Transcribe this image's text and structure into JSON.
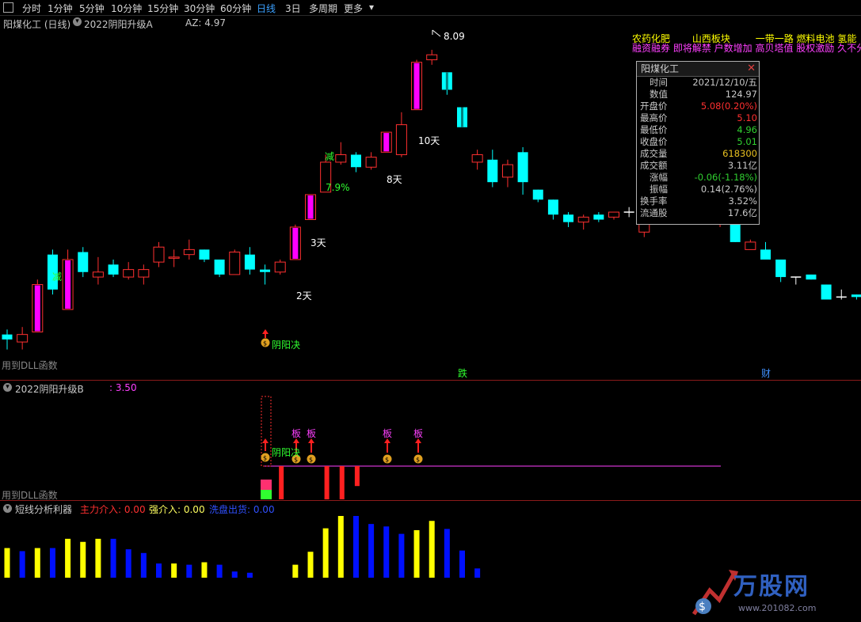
{
  "toolbar": {
    "tabs": [
      "分时",
      "1分钟",
      "5分钟",
      "10分钟",
      "15分钟",
      "30分钟",
      "60分钟",
      "日线",
      "3日",
      "多周期",
      "更多"
    ],
    "active_tab": "日线"
  },
  "main_panel": {
    "stock_title": "阳煤化工 (日线)",
    "indicator_name": "2022阴阳升级A",
    "az_label": "AZ: 4.97",
    "dll_note": "用到DLL函数",
    "high_marker": "8.09",
    "labels": {
      "jian1": "减",
      "jian2": "减",
      "pct": "7.9%",
      "day2": "2天",
      "day3": "3天",
      "day8": "8天",
      "day10": "10天",
      "yinyang": "阴阳决",
      "die": "跌",
      "cai": "财"
    },
    "concept_tags_row1": [
      "农药化肥",
      "山西板块",
      "一带一路",
      "燃料电池",
      "氢能"
    ],
    "concept_tags_row2": "融资融券 即将解禁 户数增加 高贝塔值 股权激励 久不分"
  },
  "info_box": {
    "title": "阳煤化工",
    "rows": [
      {
        "k": "时间",
        "v": "2021/12/10/五",
        "color": "#c8c8c8"
      },
      {
        "k": "数值",
        "v": "124.97",
        "color": "#c8c8c8"
      },
      {
        "k": "开盘价",
        "v": "5.08(0.20%)",
        "color": "#ff3030"
      },
      {
        "k": "最高价",
        "v": "5.10",
        "color": "#ff3030"
      },
      {
        "k": "最低价",
        "v": "4.96",
        "color": "#30d030"
      },
      {
        "k": "收盘价",
        "v": "5.01",
        "color": "#30d030"
      },
      {
        "k": "成交量",
        "v": "618300",
        "color": "#e8c020"
      },
      {
        "k": "成交额",
        "v": "3.11亿",
        "color": "#c8c8c8"
      },
      {
        "k": "涨幅",
        "v": "-0.06(-1.18%)",
        "color": "#30d030"
      },
      {
        "k": "振幅",
        "v": "0.14(2.76%)",
        "color": "#c8c8c8"
      },
      {
        "k": "换手率",
        "v": "3.52%",
        "color": "#c8c8c8"
      },
      {
        "k": "流通股",
        "v": "17.6亿",
        "color": "#c8c8c8"
      }
    ]
  },
  "panel_b": {
    "indicator_name": "2022阴阳升级B",
    "value": ": 3.50",
    "dll_note": "用到DLL函数",
    "ban_label": "板",
    "yinyang": "阴阳决"
  },
  "panel_c": {
    "indicator_name": "短线分析利器",
    "zhuli": "主力介入: 0.00",
    "qiang": "强介入: 0.00",
    "xipan": "洗盘出货: 0.00"
  },
  "watermark": {
    "brand": "万股网",
    "url": "www.201082.com"
  },
  "colors": {
    "up": "#ff3030",
    "down": "#00ffff",
    "magenta": "#ff00ff",
    "yellow": "#ffff00",
    "blue": "#0000ff",
    "green": "#30d030"
  },
  "candles": [
    {
      "o": 4.48,
      "h": 4.52,
      "l": 4.44,
      "c": 4.5,
      "t": "d"
    },
    {
      "o": 4.47,
      "h": 4.53,
      "l": 4.44,
      "c": 4.5,
      "t": "u"
    },
    {
      "o": 4.51,
      "h": 4.72,
      "l": 4.51,
      "c": 4.7,
      "t": "m"
    },
    {
      "o": 4.82,
      "h": 4.84,
      "l": 4.66,
      "c": 4.68,
      "t": "d"
    },
    {
      "o": 4.6,
      "h": 4.84,
      "l": 4.6,
      "c": 4.8,
      "t": "m"
    },
    {
      "o": 4.83,
      "h": 4.85,
      "l": 4.73,
      "c": 4.75,
      "t": "d"
    },
    {
      "o": 4.73,
      "h": 4.81,
      "l": 4.7,
      "c": 4.75,
      "t": "u"
    },
    {
      "o": 4.78,
      "h": 4.8,
      "l": 4.73,
      "c": 4.74,
      "t": "d"
    },
    {
      "o": 4.73,
      "h": 4.79,
      "l": 4.72,
      "c": 4.76,
      "t": "u"
    },
    {
      "o": 4.73,
      "h": 4.78,
      "l": 4.7,
      "c": 4.76,
      "t": "u"
    },
    {
      "o": 4.79,
      "h": 4.87,
      "l": 4.77,
      "c": 4.85,
      "t": "u"
    },
    {
      "o": 4.81,
      "h": 4.84,
      "l": 4.77,
      "c": 4.81,
      "t": "u"
    },
    {
      "o": 4.84,
      "h": 4.88,
      "l": 4.8,
      "c": 4.82,
      "t": "u"
    },
    {
      "o": 4.84,
      "h": 4.84,
      "l": 4.79,
      "c": 4.8,
      "t": "d"
    },
    {
      "o": 4.8,
      "h": 4.8,
      "l": 4.73,
      "c": 4.74,
      "t": "d"
    },
    {
      "o": 4.74,
      "h": 4.84,
      "l": 4.74,
      "c": 4.83,
      "t": "u"
    },
    {
      "o": 4.82,
      "h": 4.85,
      "l": 4.74,
      "c": 4.76,
      "t": "d"
    },
    {
      "o": 4.76,
      "h": 4.78,
      "l": 4.7,
      "c": 4.75,
      "t": "d"
    },
    {
      "o": 4.75,
      "h": 4.8,
      "l": 4.74,
      "c": 4.79,
      "t": "u"
    },
    {
      "o": 4.8,
      "h": 4.94,
      "l": 4.8,
      "c": 4.93,
      "t": "m"
    },
    {
      "o": 4.96,
      "h": 5.06,
      "l": 4.96,
      "c": 5.06,
      "t": "m"
    },
    {
      "o": 5.07,
      "h": 5.22,
      "l": 5.07,
      "c": 5.19,
      "t": "u"
    },
    {
      "o": 5.19,
      "h": 5.27,
      "l": 5.18,
      "c": 5.22,
      "t": "u"
    },
    {
      "o": 5.22,
      "h": 5.23,
      "l": 5.15,
      "c": 5.17,
      "t": "d"
    },
    {
      "o": 5.17,
      "h": 5.23,
      "l": 5.16,
      "c": 5.21,
      "t": "u"
    },
    {
      "o": 5.23,
      "h": 5.31,
      "l": 5.23,
      "c": 5.31,
      "t": "m"
    },
    {
      "o": 5.22,
      "h": 5.39,
      "l": 5.21,
      "c": 5.34,
      "t": "u"
    },
    {
      "o": 5.4,
      "h": 5.6,
      "l": 5.4,
      "c": 5.59,
      "t": "m"
    },
    {
      "o": 5.6,
      "h": 5.64,
      "l": 5.58,
      "c": 5.62,
      "t": "u"
    },
    {
      "o": 5.55,
      "h": 5.51,
      "l": 5.46,
      "c": 5.48,
      "t": "cy"
    },
    {
      "o": 5.41,
      "h": 5.41,
      "l": 5.35,
      "c": 5.33,
      "t": "cy"
    },
    {
      "o": 5.22,
      "h": 5.24,
      "l": 5.16,
      "c": 5.19,
      "t": "u"
    },
    {
      "o": 5.2,
      "h": 5.24,
      "l": 5.09,
      "c": 5.11,
      "t": "d"
    },
    {
      "o": 5.13,
      "h": 5.2,
      "l": 5.09,
      "c": 5.18,
      "t": "u"
    },
    {
      "o": 5.23,
      "h": 5.25,
      "l": 5.06,
      "c": 5.11,
      "t": "d"
    },
    {
      "o": 5.08,
      "h": 5.08,
      "l": 5.03,
      "c": 5.04,
      "t": "d"
    },
    {
      "o": 5.04,
      "h": 5.04,
      "l": 4.96,
      "c": 4.98,
      "t": "d"
    },
    {
      "o": 4.98,
      "h": 4.99,
      "l": 4.93,
      "c": 4.95,
      "t": "d"
    },
    {
      "o": 4.95,
      "h": 4.98,
      "l": 4.92,
      "c": 4.97,
      "t": "u"
    },
    {
      "o": 4.96,
      "h": 4.99,
      "l": 4.95,
      "c": 4.98,
      "t": "d"
    },
    {
      "o": 4.97,
      "h": 4.99,
      "l": 4.96,
      "c": 4.99,
      "t": "u"
    },
    {
      "o": 4.99,
      "h": 5.01,
      "l": 4.97,
      "c": 4.99,
      "t": "x"
    },
    {
      "o": 4.91,
      "h": 4.98,
      "l": 4.89,
      "c": 4.95,
      "t": "u"
    },
    {
      "o": 4.96,
      "h": 5.03,
      "l": 4.96,
      "c": 5.02,
      "t": "u"
    },
    {
      "o": 5.0,
      "h": 5.03,
      "l": 4.95,
      "c": 4.95,
      "t": "d"
    },
    {
      "o": 4.95,
      "h": 5.0,
      "l": 4.95,
      "c": 4.98,
      "t": "u"
    },
    {
      "o": 5.03,
      "h": 5.03,
      "l": 4.97,
      "c": 4.99,
      "t": "d"
    },
    {
      "o": 4.96,
      "h": 4.99,
      "l": 4.93,
      "c": 4.97,
      "t": "u"
    },
    {
      "o": 4.96,
      "h": 4.96,
      "l": 4.87,
      "c": 4.87,
      "t": "d"
    },
    {
      "o": 4.84,
      "h": 4.88,
      "l": 4.84,
      "c": 4.87,
      "t": "u"
    },
    {
      "o": 4.84,
      "h": 4.87,
      "l": 4.8,
      "c": 4.8,
      "t": "d"
    },
    {
      "o": 4.8,
      "h": 4.8,
      "l": 4.71,
      "c": 4.73,
      "t": "d"
    },
    {
      "o": 4.73,
      "h": 4.73,
      "l": 4.7,
      "c": 4.73,
      "t": "x"
    },
    {
      "o": 4.74,
      "h": 4.74,
      "l": 4.72,
      "c": 4.72,
      "t": "d"
    },
    {
      "o": 4.7,
      "h": 4.7,
      "l": 4.64,
      "c": 4.64,
      "t": "d"
    },
    {
      "o": 4.65,
      "h": 4.68,
      "l": 4.64,
      "c": 4.65,
      "t": "x"
    },
    {
      "o": 4.66,
      "h": 4.66,
      "l": 4.64,
      "c": 4.65,
      "t": "d"
    }
  ],
  "panel_b_bars": [
    {
      "i": 17,
      "v": 0.6,
      "c": "mix"
    },
    {
      "i": 18,
      "v": 1.0,
      "c": "red"
    },
    {
      "i": 21,
      "v": 1.0,
      "c": "red"
    },
    {
      "i": 22,
      "v": 1.0,
      "c": "red"
    },
    {
      "i": 23,
      "v": 0.6,
      "c": "red"
    }
  ],
  "panel_c_bars": [
    {
      "i": 0,
      "v": 0.48,
      "c": "y"
    },
    {
      "i": 1,
      "v": 0.43,
      "c": "b"
    },
    {
      "i": 2,
      "v": 0.48,
      "c": "y"
    },
    {
      "i": 3,
      "v": 0.48,
      "c": "b"
    },
    {
      "i": 4,
      "v": 0.63,
      "c": "y"
    },
    {
      "i": 5,
      "v": 0.58,
      "c": "y"
    },
    {
      "i": 6,
      "v": 0.63,
      "c": "y"
    },
    {
      "i": 7,
      "v": 0.63,
      "c": "b"
    },
    {
      "i": 8,
      "v": 0.46,
      "c": "b"
    },
    {
      "i": 9,
      "v": 0.4,
      "c": "b"
    },
    {
      "i": 10,
      "v": 0.23,
      "c": "b"
    },
    {
      "i": 11,
      "v": 0.23,
      "c": "y"
    },
    {
      "i": 12,
      "v": 0.21,
      "c": "b"
    },
    {
      "i": 13,
      "v": 0.25,
      "c": "y"
    },
    {
      "i": 14,
      "v": 0.21,
      "c": "b"
    },
    {
      "i": 15,
      "v": 0.1,
      "c": "b"
    },
    {
      "i": 16,
      "v": 0.08,
      "c": "b"
    },
    {
      "i": 19,
      "v": 0.21,
      "c": "y"
    },
    {
      "i": 20,
      "v": 0.42,
      "c": "y"
    },
    {
      "i": 21,
      "v": 0.8,
      "c": "y"
    },
    {
      "i": 22,
      "v": 1.0,
      "c": "y"
    },
    {
      "i": 23,
      "v": 1.0,
      "c": "b"
    },
    {
      "i": 24,
      "v": 0.87,
      "c": "b"
    },
    {
      "i": 25,
      "v": 0.83,
      "c": "b"
    },
    {
      "i": 26,
      "v": 0.71,
      "c": "b"
    },
    {
      "i": 27,
      "v": 0.77,
      "c": "y"
    },
    {
      "i": 28,
      "v": 0.92,
      "c": "y"
    },
    {
      "i": 29,
      "v": 0.79,
      "c": "b"
    },
    {
      "i": 30,
      "v": 0.44,
      "c": "b"
    },
    {
      "i": 31,
      "v": 0.15,
      "c": "b"
    }
  ]
}
